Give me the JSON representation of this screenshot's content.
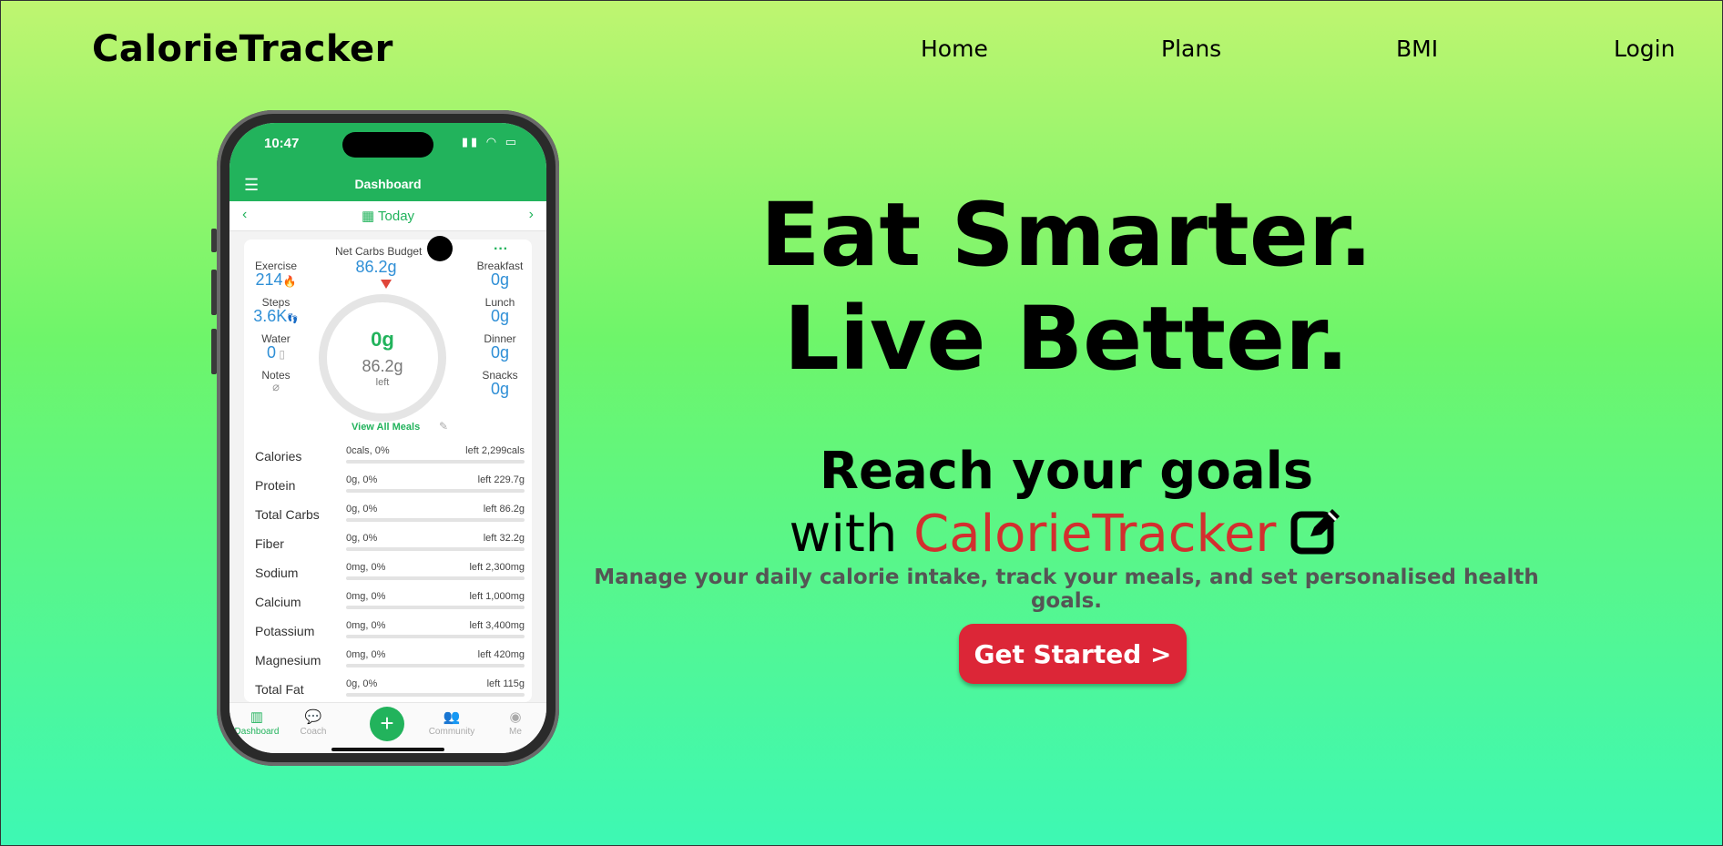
{
  "nav": {
    "brand": "CalorieTracker",
    "links": [
      "Home",
      "Plans",
      "BMI",
      "Login"
    ]
  },
  "phone": {
    "time": "10:47",
    "appbar_title": "Dashboard",
    "date_label": "Today",
    "budget": {
      "label": "Net Carbs Budget",
      "value": "86.2g"
    },
    "left_stats": [
      {
        "label": "Exercise",
        "value": "214"
      },
      {
        "label": "Steps",
        "value": "3.6K"
      },
      {
        "label": "Water",
        "value": "0"
      },
      {
        "label": "Notes",
        "value": ""
      }
    ],
    "right_stats": [
      {
        "label": "Breakfast",
        "value": "0g"
      },
      {
        "label": "Lunch",
        "value": "0g"
      },
      {
        "label": "Dinner",
        "value": "0g"
      },
      {
        "label": "Snacks",
        "value": "0g"
      }
    ],
    "ring": {
      "main": "0g",
      "sub": "86.2g",
      "caption": "left"
    },
    "view_all_meals": "View All Meals",
    "nutrients": [
      {
        "name": "Calories",
        "used": "0cals, 0%",
        "left": "left 2,299cals"
      },
      {
        "name": "Protein",
        "used": "0g, 0%",
        "left": "left 229.7g"
      },
      {
        "name": "Total Carbs",
        "used": "0g, 0%",
        "left": "left 86.2g"
      },
      {
        "name": "Fiber",
        "used": "0g, 0%",
        "left": "left 32.2g"
      },
      {
        "name": "Sodium",
        "used": "0mg, 0%",
        "left": "left 2,300mg"
      },
      {
        "name": "Calcium",
        "used": "0mg, 0%",
        "left": "left 1,000mg"
      },
      {
        "name": "Potassium",
        "used": "0mg, 0%",
        "left": "left 3,400mg"
      },
      {
        "name": "Magnesium",
        "used": "0mg, 0%",
        "left": "left 420mg"
      },
      {
        "name": "Total Fat",
        "used": "0g, 0%",
        "left": "left 115g"
      }
    ],
    "tabs": [
      "Dashboard",
      "Coach",
      "Community",
      "Me"
    ],
    "accent": "#22b35c",
    "value_color": "#2f8fd6"
  },
  "hero": {
    "line1": "Eat Smarter.",
    "line2": "Live Better.",
    "sub1": "Reach your goals",
    "sub2_prefix": "with ",
    "sub2_brand": "CalorieTracker",
    "tagline": "Manage your daily calorie intake, track your meals, and set personalised health goals.",
    "cta": "Get Started >",
    "cta_color": "#dc2637",
    "brand_color": "#d32f2f"
  },
  "icons": [
    "hamburger-menu-icon",
    "calendar-icon",
    "chevron-left-icon",
    "chevron-right-icon",
    "flame-icon",
    "footsteps-icon",
    "glass-icon",
    "paperclip-icon",
    "pencil-icon",
    "edit-square-icon",
    "plus-icon"
  ]
}
